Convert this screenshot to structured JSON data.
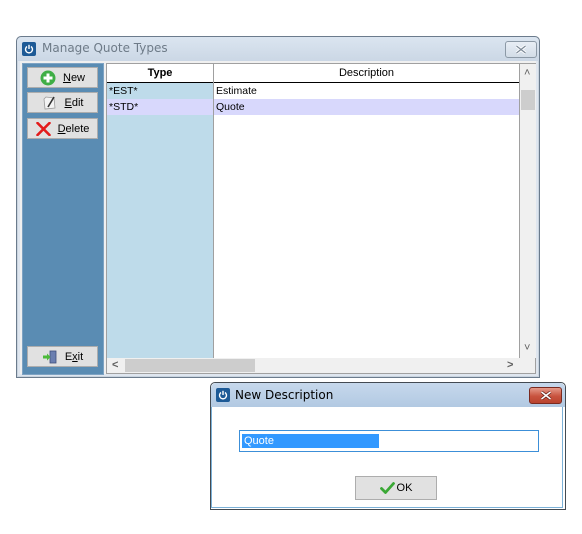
{
  "main_window": {
    "title": "Manage Quote Types",
    "close_label": "Close",
    "toolbar": {
      "new": {
        "prefix": "",
        "underline": "N",
        "suffix": "ew",
        "icon": "plus-circle-icon"
      },
      "edit": {
        "prefix": "",
        "underline": "E",
        "suffix": "dit",
        "icon": "edit-pencil-icon"
      },
      "delete": {
        "prefix": "",
        "underline": "D",
        "suffix": "elete",
        "icon": "red-x-icon"
      },
      "exit": {
        "prefix": "E",
        "underline": "x",
        "suffix": "it",
        "icon": "exit-door-icon"
      }
    },
    "grid": {
      "columns": [
        "Type",
        "Description"
      ],
      "rows": [
        {
          "type": "*EST*",
          "description": "Estimate",
          "selected": false
        },
        {
          "type": "*STD*",
          "description": "Quote",
          "selected": true
        }
      ],
      "scroll_up": "˄",
      "scroll_down": "˅",
      "scroll_left": "<",
      "scroll_right": ">"
    }
  },
  "dialog": {
    "title": "New Description",
    "input_value": "Quote",
    "ok_label": "OK"
  },
  "colors": {
    "left_panel": "#5a8cb3",
    "type_column": "#bedbea",
    "selected_row": "#d8d8fc",
    "text_selection": "#3399ff"
  }
}
